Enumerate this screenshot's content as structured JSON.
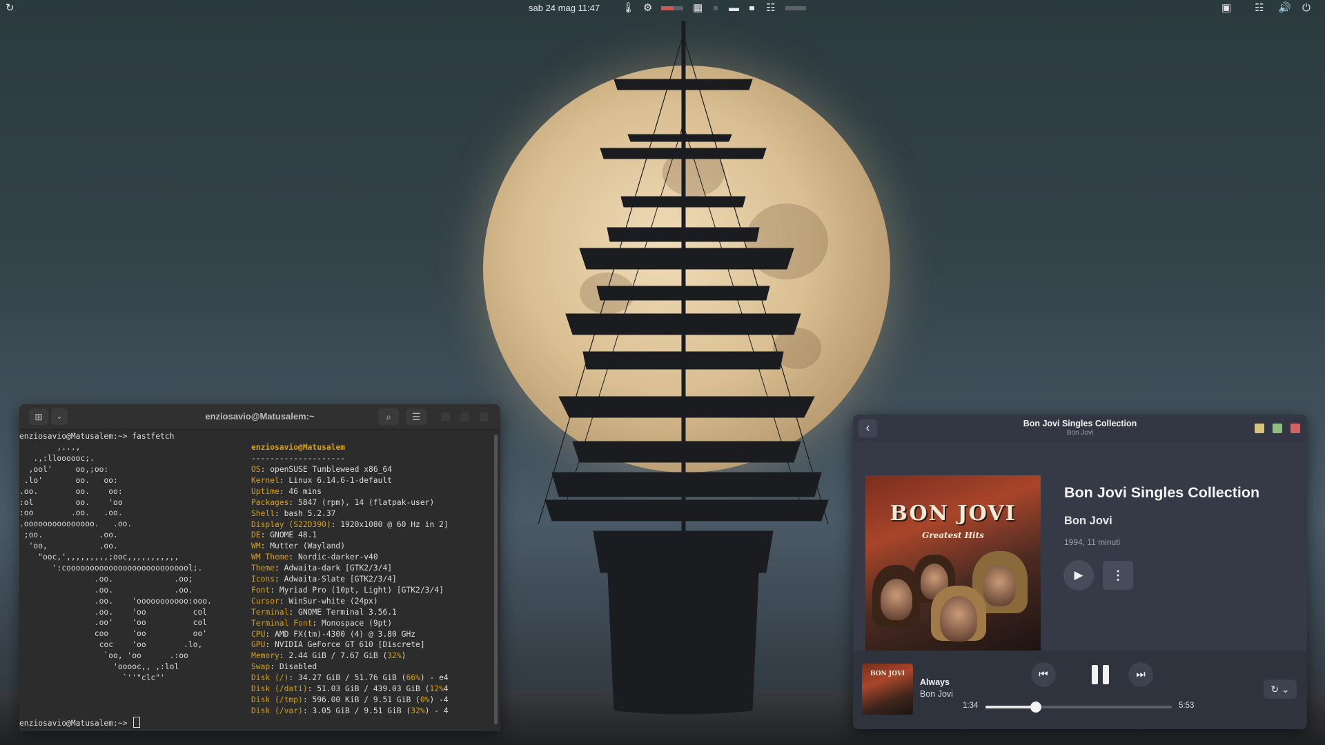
{
  "topbar": {
    "clock": "sab 24 mag  11:47"
  },
  "terminal": {
    "title": "enziosavio@Matusalem:~",
    "prompt_command": "enziosavio@Matusalem:~> fastfetch",
    "prompt_end": "enziosavio@Matusalem:~> ",
    "logo": [
      "        ,...,",
      "   .,:lloooooc;.",
      "  ,ool'     oo,;oo:",
      " .lo'       oo.   oo:",
      ".oo.        oo.    oo:",
      ":ol         oo.    'oo",
      ":oo        .oo.   .oo.",
      ".ooooooooooooooo.   .oo.",
      " ;oo.            .oo.",
      "  'oo,           .oo.",
      "    \"ooc,',,,,,,,,,;ooc,,,,,,,,,,,",
      "       ':cooooooooooooooooooooooooool;.",
      "                .oo.             .oo;",
      "                .oo.             .oo.",
      "                .oo.    'ooooooooooo:ooo.",
      "                .oo.    'oo          col",
      "                .oo'    'oo          col",
      "                coo     'oo          oo'",
      "                 coc    'oo        .lo,",
      "                  `oo, 'oo      .:oo",
      "                    'ooooc,, ,:lol",
      "                      `''\"clc\"'"
    ],
    "host": "enziosavio@Matusalem",
    "separator": "--------------------",
    "info": [
      {
        "key": "OS",
        "value": ": openSUSE Tumbleweed x86_64"
      },
      {
        "key": "Kernel",
        "value": ": Linux 6.14.6-1-default"
      },
      {
        "key": "Uptime",
        "value": ": 46 mins"
      },
      {
        "key": "Packages",
        "value": ": 5847 (rpm), 14 (flatpak-user)"
      },
      {
        "key": "Shell",
        "value": ": bash 5.2.37"
      },
      {
        "key": "Display (S22D390)",
        "value": ": 1920x1080 @ 60 Hz in 2]"
      },
      {
        "key": "DE",
        "value": ": GNOME 48.1"
      },
      {
        "key": "WM",
        "value": ": Mutter (Wayland)"
      },
      {
        "key": "WM Theme",
        "value": ": Nordic-darker-v40"
      },
      {
        "key": "Theme",
        "value": ": Adwaita-dark [GTK2/3/4]"
      },
      {
        "key": "Icons",
        "value": ": Adwaita-Slate [GTK2/3/4]"
      },
      {
        "key": "Font",
        "value": ": Myriad Pro (10pt, Light) [GTK2/3/4]"
      },
      {
        "key": "Cursor",
        "value": ": WinSur-white (24px)"
      },
      {
        "key": "Terminal",
        "value": ": GNOME Terminal 3.56.1"
      },
      {
        "key": "Terminal Font",
        "value": ": Monospace (9pt)"
      },
      {
        "key": "CPU",
        "value": ": AMD FX(tm)-4300 (4) @ 3.80 GHz"
      },
      {
        "key": "GPU",
        "value": ": NVIDIA GeForce GT 610 [Discrete]"
      },
      {
        "key": "Memory",
        "value": ": 2.44 GiB / 7.67 GiB (",
        "pct": "32%",
        "tail": ")"
      },
      {
        "key": "Swap",
        "value": ": Disabled"
      },
      {
        "key": "Disk (/)",
        "value": ": 34.27 GiB / 51.76 GiB (",
        "pct": "66%",
        "tail": ") - e4"
      },
      {
        "key": "Disk (/dati)",
        "value": ": 51.03 GiB / 439.03 GiB (",
        "pct": "12%",
        "tail": "4"
      },
      {
        "key": "Disk (/tmp)",
        "value": ": 596.00 KiB / 9.51 GiB (",
        "pct": "0%",
        "tail": ") -4"
      },
      {
        "key": "Disk (/var)",
        "value": ": 3.05 GiB / 9.51 GiB (",
        "pct": "32%",
        "tail": ") - 4"
      }
    ]
  },
  "player": {
    "header_title": "Bon Jovi Singles Collection",
    "header_subtitle": "Bon Jovi",
    "album_title": "Bon Jovi Singles Collection",
    "album_artist": "Bon Jovi",
    "album_meta": "1994, 11 minuti",
    "cover_band": "BON JOVI",
    "cover_subtitle": "Greatest Hits",
    "now_playing": {
      "title": "Always",
      "artist": "Bon Jovi",
      "elapsed": "1:34",
      "total": "5:53",
      "progress": 0.27
    },
    "window_colors": {
      "minimize": "#d6c47a",
      "maximize": "#8fbf7f",
      "close": "#d06464"
    }
  }
}
